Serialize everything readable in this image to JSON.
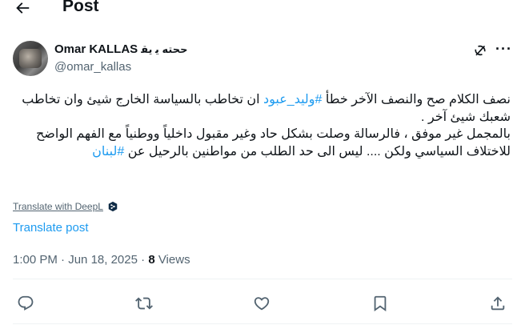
{
  "header": {
    "title": "Post"
  },
  "author": {
    "name": "Omar KALLAS",
    "name_arabic": "ﺣﺤﺘﻪ ﻳ ﻳﻘ",
    "handle": "@omar_kallas"
  },
  "post": {
    "line1_pre": "نصف الكلام صح والنصف الآخر خطأ ",
    "hashtag1": "#وليد_عبود",
    "line1_post": " ان تخاطب بالسياسة الخارج شيئ وان تخاطب شعبك شيئ آخر .",
    "line2": "بالمجمل غير موفق ، فالرسالة وصلت بشكل حاد وغير مقبول داخلياً ووطنياً مع الفهم الواضح للاختلاف السياسي ولكن .... ليس الى حد الطلب من مواطنين بالرحيل عن",
    "hashtag2": "#لبنان"
  },
  "translate_deepl": "Translate with DeepL",
  "translate_post": "Translate post",
  "meta": {
    "time": "1:00 PM",
    "sep": " · ",
    "date": "Jun 18, 2025",
    "views_count": "8",
    "views_label": " Views"
  },
  "icons": {
    "back": "arrow-left-icon",
    "grok": "grok-icon",
    "more": "more-icon",
    "reply": "reply-icon",
    "repost": "repost-icon",
    "like": "heart-icon",
    "bookmark": "bookmark-icon",
    "share": "share-icon"
  },
  "colors": {
    "accent": "#1d9bf0",
    "text": "#0f1419",
    "secondary": "#536471"
  }
}
